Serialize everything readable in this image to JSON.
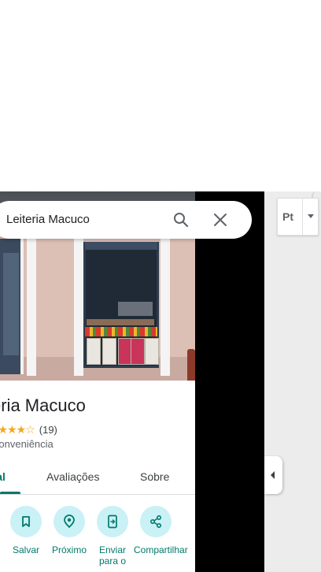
{
  "search": {
    "value": "Leiteria Macuco"
  },
  "place": {
    "title": "eria Macuco",
    "stars": "★★★★☆",
    "review_count": "(19)",
    "category": "Conveniência"
  },
  "tabs": [
    {
      "label": "eral",
      "active": true
    },
    {
      "label": "Avaliações",
      "active": false
    },
    {
      "label": "Sobre",
      "active": false
    }
  ],
  "actions": [
    {
      "label": "Salvar",
      "icon": "bookmark-icon"
    },
    {
      "label": "Próximo",
      "icon": "nearby-icon"
    },
    {
      "label": "Enviar para o",
      "icon": "send-to-phone-icon"
    },
    {
      "label": "Compartilhar",
      "icon": "share-icon"
    }
  ],
  "map_controls": {
    "layers_label": "Pt"
  },
  "colors": {
    "accent": "#00796b",
    "action_circle": "#c9f1f6",
    "star": "#f3a81d",
    "dark_panel": "#000000",
    "map_bg": "#ececec"
  }
}
